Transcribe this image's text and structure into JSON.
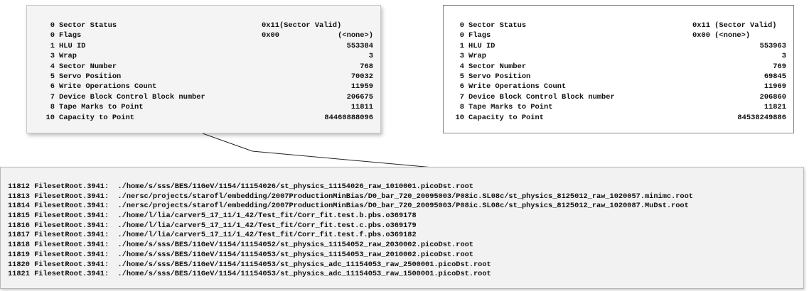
{
  "left_panel": {
    "rows": [
      {
        "num": "0",
        "label": "Sector Status",
        "v1": "0x11(Sector Valid)",
        "v2": ""
      },
      {
        "num": "0",
        "label": "Flags",
        "v1": "0x00",
        "v2": "(<none>)"
      },
      {
        "num": "1",
        "label": "HLU ID",
        "v1": "",
        "v2": "553384"
      },
      {
        "num": "3",
        "label": "Wrap",
        "v1": "",
        "v2": "3"
      },
      {
        "num": "4",
        "label": "Sector Number",
        "v1": "",
        "v2": "768"
      },
      {
        "num": "5",
        "label": "Servo Position",
        "v1": "",
        "v2": "70032"
      },
      {
        "num": "6",
        "label": "Write Operations Count",
        "v1": "",
        "v2": "11959"
      },
      {
        "num": "7",
        "label": "Device Block Control Block number",
        "v1": "",
        "v2": "206675"
      },
      {
        "num": "8",
        "label": "Tape Marks to Point",
        "v1": "",
        "v2": "11811"
      },
      {
        "num": "10",
        "label": "Capacity to Point",
        "v1": "",
        "v2": "84460888096"
      }
    ]
  },
  "right_panel": {
    "rows": [
      {
        "num": "0",
        "label": "Sector Status",
        "v1": "0x11 (Sector Valid)",
        "v2": ""
      },
      {
        "num": "0",
        "label": "Flags",
        "v1": "0x00 (<none>)",
        "v2": ""
      },
      {
        "num": "1",
        "label": "HLU ID",
        "v1": "",
        "v2": "553963"
      },
      {
        "num": "3",
        "label": "Wrap",
        "v1": "",
        "v2": "3"
      },
      {
        "num": "4",
        "label": "Sector Number",
        "v1": "",
        "v2": "769"
      },
      {
        "num": "5",
        "label": "Servo Position",
        "v1": "",
        "v2": "69845"
      },
      {
        "num": "6",
        "label": "Write Operations Count",
        "v1": "",
        "v2": "11969"
      },
      {
        "num": "7",
        "label": "Device Block Control Block number",
        "v1": "",
        "v2": "206860"
      },
      {
        "num": "8",
        "label": "Tape Marks to Point",
        "v1": "",
        "v2": "11821"
      },
      {
        "num": "10",
        "label": "Capacity to Point",
        "v1": "",
        "v2": "84538249886"
      }
    ]
  },
  "file_list": {
    "lines": [
      "11812 FilesetRoot.3941:  ./home/s/sss/BES/11GeV/1154/11154026/st_physics_11154026_raw_1010001.picoDst.root",
      "11813 FilesetRoot.3941:  ./nersc/projects/starofl/embedding/2007ProductionMinBias/D0_bar_720_20095003/P08ic.SL08c/st_physics_8125012_raw_1020057.minimc.root",
      "11814 FilesetRoot.3941:  ./nersc/projects/starofl/embedding/2007ProductionMinBias/D0_bar_720_20095003/P08ic.SL08c/st_physics_8125012_raw_1020087.MuDst.root",
      "11815 FilesetRoot.3941:  ./home/l/lia/carver5_17_11/1_42/Test_fit/Corr_fit.test.b.pbs.o369178",
      "11816 FilesetRoot.3941:  ./home/l/lia/carver5_17_11/1_42/Test_fit/Corr_fit.test.c.pbs.o369179",
      "11817 FilesetRoot.3941:  ./home/l/lia/carver5_17_11/1_42/Test_fit/Corr_fit.test.f.pbs.o369182",
      "11818 FilesetRoot.3941:  ./home/s/sss/BES/11GeV/1154/11154052/st_physics_11154052_raw_2030002.picoDst.root",
      "11819 FilesetRoot.3941:  ./home/s/sss/BES/11GeV/1154/11154053/st_physics_11154053_raw_2010002.picoDst.root",
      "11820 FilesetRoot.3941:  ./home/s/sss/BES/11GeV/1154/11154053/st_physics_adc_11154053_raw_2500001.picoDst.root",
      "11821 FilesetRoot.3941:  ./home/s/sss/BES/11GeV/1154/11154053/st_physics_adc_11154053_raw_1500001.picoDst.root"
    ]
  }
}
